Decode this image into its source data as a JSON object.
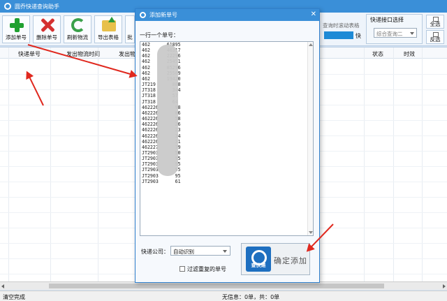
{
  "app": {
    "title": "圆乔快递查询助手"
  },
  "toolbar": {
    "add": "添加单号",
    "delete": "删除单号",
    "refresh": "刷新物流",
    "export": "导出表格",
    "batch": "批"
  },
  "realtime": {
    "label": "查询时滚动表格",
    "speed": "快"
  },
  "port": {
    "title": "快递接口选择",
    "value": "综合查询二"
  },
  "side_buttons": {
    "select_all": "全选",
    "invert": "反选"
  },
  "table": {
    "headers": [
      "快递单号",
      "发出物流时间",
      "发出物",
      "状态",
      "时效"
    ]
  },
  "status": {
    "left": "清空完成",
    "right": "无信息：0单，共：0单"
  },
  "dialog": {
    "title": "添加新单号",
    "close": "✕",
    "instruction": "一行一个单号：",
    "lines": [
      "462      61895",
      "462      46317",
      "462      22296",
      "462      25451",
      "462      85296",
      "462      25569",
      "462      19420",
      "JT219      888",
      "JT318      344",
      "JT318      57",
      "JT318      64",
      "462226      98",
      "462226      06",
      "462226      58",
      "462226      26",
      "462226      23",
      "462226      34",
      "462226      31",
      "462227      79",
      "JT2903      50",
      "JT2903      95",
      "JT2903      95",
      "JT2903      95",
      "JT2903      95",
      "JT2903      61"
    ],
    "company_label": "快递公司：",
    "company_value": "自动识别",
    "filter_label": "过滤重复的单号",
    "confirm_label": "确定添加",
    "confirm_icon_text": "查快递"
  }
}
